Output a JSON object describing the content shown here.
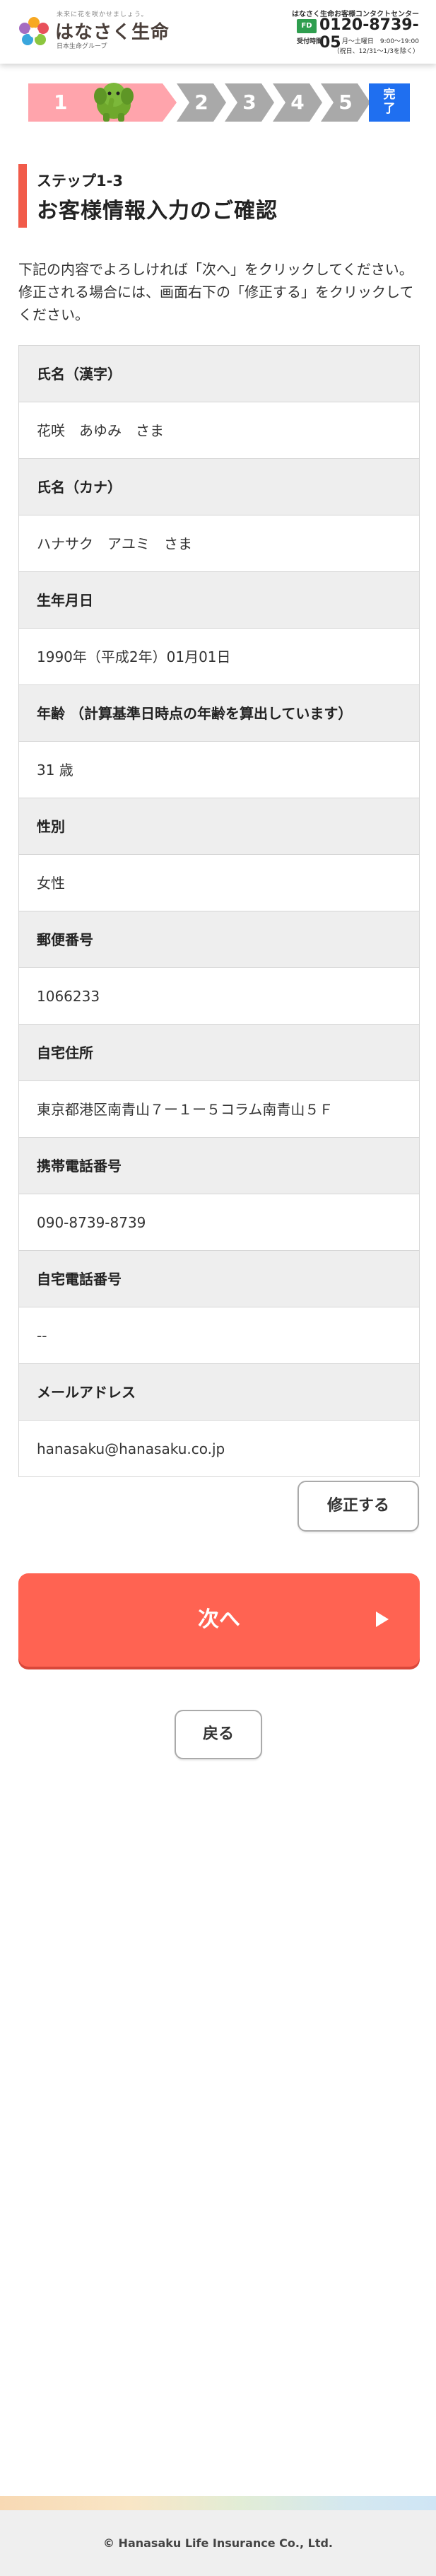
{
  "header": {
    "logo_tagline": "未来に花を咲かせましょう。",
    "logo_name": "はなさく生命",
    "logo_sub": "日本生命グループ",
    "contact_title": "はなさく生命お客様コンタクトセンター",
    "free_dial_badge": "FD",
    "phone": "0120-8739-05",
    "hours_label": "受付時間",
    "hours": "月〜土曜日　9:00〜19:00",
    "break_note": "（祝日、12/31〜1/3を除く）"
  },
  "steps": {
    "current": "1",
    "items": [
      "2",
      "3",
      "4",
      "5"
    ],
    "done_label_1": "完",
    "done_label_2": "了"
  },
  "page": {
    "step_label": "ステップ1-3",
    "title": "お客様情報入力のご確認",
    "intro": "下記の内容でよろしければ「次へ」をクリックしてください。修正される場合には、画面右下の「修正する」をクリックしてください。"
  },
  "fields": [
    {
      "label": "氏名（漢字）",
      "value": "花咲　あゆみ　さま"
    },
    {
      "label": "氏名（カナ）",
      "value": "ハナサク　アユミ　さま"
    },
    {
      "label": "生年月日",
      "value": "1990年（平成2年）01月01日"
    },
    {
      "label": "年齢 （計算基準日時点の年齢を算出しています）",
      "value": "31 歳"
    },
    {
      "label": "性別",
      "value": "女性"
    },
    {
      "label": "郵便番号",
      "value": "1066233"
    },
    {
      "label": "自宅住所",
      "value": "東京都港区南青山７ー１ー５コラム南青山５Ｆ"
    },
    {
      "label": "携帯電話番号",
      "value": "090-8739-8739"
    },
    {
      "label": "自宅電話番号",
      "value": "--"
    },
    {
      "label": "メールアドレス",
      "value": "hanasaku@hanasaku.co.jp"
    }
  ],
  "buttons": {
    "edit": "修正する",
    "next": "次へ",
    "back": "戻る"
  },
  "footer": {
    "copyright": "© Hanasaku Life Insurance Co., Ltd."
  },
  "colors": {
    "accent": "#ff6352",
    "step_current": "#ffa4ac",
    "step_inactive": "#a9a9a9",
    "step_done": "#1f6ff0",
    "title_bar": "#f15b4a"
  }
}
